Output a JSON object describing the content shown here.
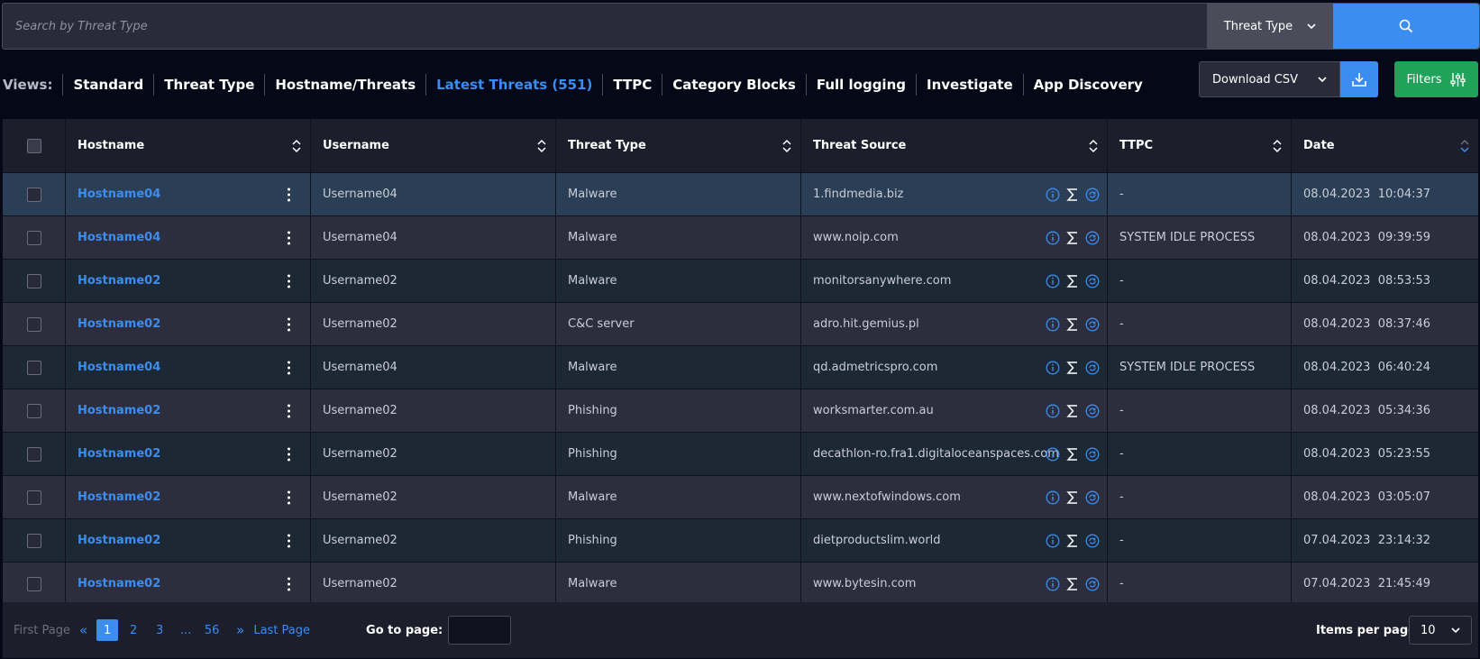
{
  "search": {
    "placeholder": "Search by Threat Type",
    "type_label": "Threat Type"
  },
  "views": {
    "label": "Views:",
    "items": [
      "Standard",
      "Threat Type",
      "Hostname/Threats",
      "Latest Threats (551)",
      "TTPC",
      "Category Blocks",
      "Full logging",
      "Investigate",
      "App Discovery"
    ],
    "active_index": 3
  },
  "toolbar": {
    "csv_label": "Download CSV",
    "filters_label": "Filters"
  },
  "table": {
    "headers": [
      "Hostname",
      "Username",
      "Threat Type",
      "Threat Source",
      "TTPC",
      "Date"
    ],
    "rows": [
      {
        "hostname": "Hostname04",
        "username": "Username04",
        "threat_type": "Malware",
        "source": "1.findmedia.biz",
        "ttpc": "-",
        "date": "08.04.2023  10:04:37"
      },
      {
        "hostname": "Hostname04",
        "username": "Username04",
        "threat_type": "Malware",
        "source": "www.noip.com",
        "ttpc": "SYSTEM IDLE PROCESS",
        "date": "08.04.2023  09:39:59"
      },
      {
        "hostname": "Hostname02",
        "username": "Username02",
        "threat_type": "Malware",
        "source": "monitorsanywhere.com",
        "ttpc": "-",
        "date": "08.04.2023  08:53:53"
      },
      {
        "hostname": "Hostname02",
        "username": "Username02",
        "threat_type": "C&C server",
        "source": "adro.hit.gemius.pl",
        "ttpc": "-",
        "date": "08.04.2023  08:37:46"
      },
      {
        "hostname": "Hostname04",
        "username": "Username04",
        "threat_type": "Malware",
        "source": "qd.admetricspro.com",
        "ttpc": "SYSTEM IDLE PROCESS",
        "date": "08.04.2023  06:40:24"
      },
      {
        "hostname": "Hostname02",
        "username": "Username02",
        "threat_type": "Phishing",
        "source": "worksmarter.com.au",
        "ttpc": "-",
        "date": "08.04.2023  05:34:36"
      },
      {
        "hostname": "Hostname02",
        "username": "Username02",
        "threat_type": "Phishing",
        "source": "decathlon-ro.fra1.digitaloceanspaces.com",
        "ttpc": "-",
        "date": "08.04.2023  05:23:55"
      },
      {
        "hostname": "Hostname02",
        "username": "Username02",
        "threat_type": "Malware",
        "source": "www.nextofwindows.com",
        "ttpc": "-",
        "date": "08.04.2023  03:05:07"
      },
      {
        "hostname": "Hostname02",
        "username": "Username02",
        "threat_type": "Phishing",
        "source": "dietproductslim.world",
        "ttpc": "-",
        "date": "07.04.2023  23:14:32"
      },
      {
        "hostname": "Hostname02",
        "username": "Username02",
        "threat_type": "Malware",
        "source": "www.bytesin.com",
        "ttpc": "-",
        "date": "07.04.2023  21:45:49"
      }
    ]
  },
  "pagination": {
    "first_label": "First Page",
    "last_label": "Last Page",
    "pages": [
      "1",
      "2",
      "3",
      "...",
      "56"
    ],
    "current": "1",
    "goto_label": "Go to page:",
    "items_per_page_label": "Items per page:",
    "items_per_page": "10"
  },
  "colors": {
    "accent": "#3b8df2",
    "filters": "#1fa25a",
    "background": "#050817"
  }
}
